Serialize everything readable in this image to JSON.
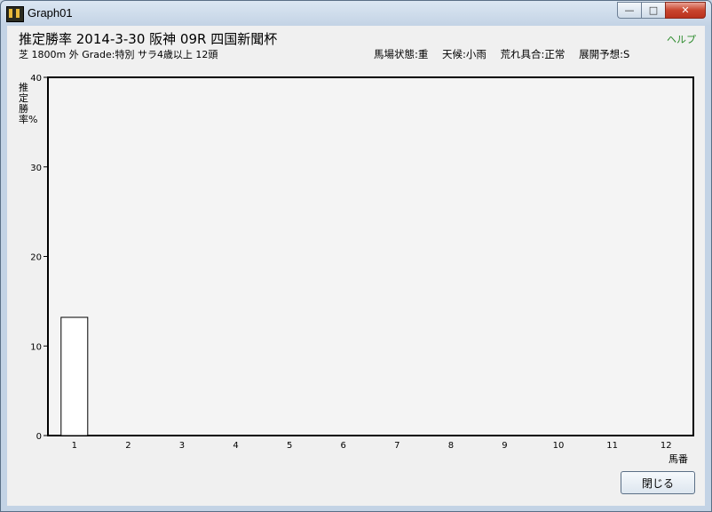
{
  "window": {
    "title": "Graph01",
    "controls": [
      "minimize",
      "maximize",
      "close"
    ]
  },
  "header": {
    "title": "推定勝率  2014-3-30  阪神  09R  四国新聞杯",
    "subtitle": "芝 1800m 外  Grade:特別  サラ4歳以上  12頭",
    "conditions": [
      "馬場状態:重",
      "天候:小雨",
      "荒れ具合:正常",
      "展開予想:S"
    ],
    "help": "ヘルプ"
  },
  "chart_data": {
    "type": "bar",
    "categories": [
      "1",
      "2",
      "3",
      "4",
      "5",
      "6",
      "7",
      "8",
      "9",
      "10",
      "11",
      "12"
    ],
    "values": [
      13.2,
      0,
      0,
      0,
      0,
      0,
      0,
      0,
      0,
      0,
      0,
      0
    ],
    "ylabel": "推定勝率%",
    "xlabel": "馬番",
    "ylim": [
      0,
      40
    ],
    "yticks": [
      0,
      10,
      20,
      30,
      40
    ],
    "grid": false,
    "bar_color": "#ffffff",
    "bar_edge": "#000000"
  },
  "buttons": {
    "close": "閉じる"
  }
}
